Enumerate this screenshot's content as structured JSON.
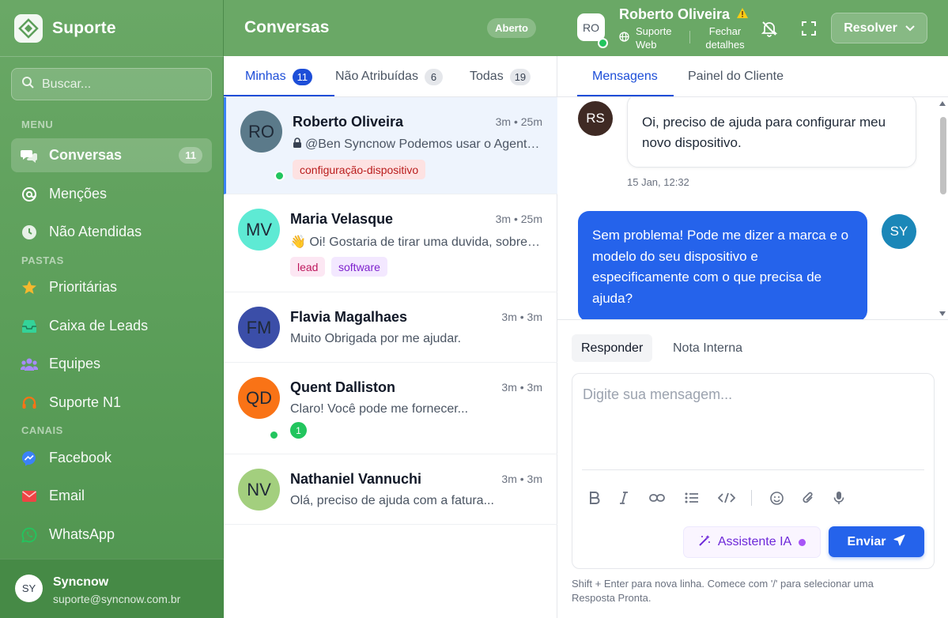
{
  "sidebar": {
    "brand": "Suporte",
    "search_placeholder": "Buscar...",
    "menu_label": "MENU",
    "folders_label": "PASTAS",
    "channels_label": "CANAIS",
    "menu": [
      {
        "label": "Conversas",
        "count": "11",
        "icon": "chat-bubbles-icon"
      },
      {
        "label": "Menções",
        "icon": "at-sign-icon"
      },
      {
        "label": "Não Atendidas",
        "icon": "clock-icon"
      }
    ],
    "folders": [
      {
        "label": "Prioritárias",
        "icon": "star-icon",
        "color": "#f5b82e"
      },
      {
        "label": "Caixa de Leads",
        "icon": "inbox-icon",
        "color": "#34d399"
      },
      {
        "label": "Equipes",
        "icon": "users-icon",
        "color": "#a78bfa"
      },
      {
        "label": "Suporte N1",
        "icon": "headset-icon",
        "color": "#f97316"
      }
    ],
    "channels": [
      {
        "label": "Facebook",
        "icon": "messenger-icon",
        "color": "#3b82f6"
      },
      {
        "label": "Email",
        "icon": "envelope-icon",
        "color": "#ef4444"
      },
      {
        "label": "WhatsApp",
        "icon": "whatsapp-icon",
        "color": "#22c55e"
      }
    ],
    "user": {
      "initials": "SY",
      "name": "Syncnow",
      "email": "suporte@syncnow.com.br"
    }
  },
  "conversations": {
    "title": "Conversas",
    "status": "Aberto",
    "tabs": [
      {
        "label": "Minhas",
        "count": "11"
      },
      {
        "label": "Não Atribuídas",
        "count": "6"
      },
      {
        "label": "Todas",
        "count": "19"
      }
    ],
    "items": [
      {
        "initials": "RO",
        "name": "Roberto Oliveira",
        "time": "3m • 25m",
        "preview": "@Ben Syncnow Podemos usar o Agente de IA para ajudar?",
        "tags": [
          "configuração-dispositivo"
        ],
        "avatar_color": "#5b7a8a",
        "online": true
      },
      {
        "initials": "MV",
        "name": "Maria Velasque",
        "time": "3m • 25m",
        "preview": "👋 Oi! Gostaria de tirar uma duvida, sobre o produto",
        "tags": [
          "lead",
          "software"
        ],
        "avatar_color": "#5eead4",
        "online": false
      },
      {
        "initials": "FM",
        "name": "Flavia Magalhaes",
        "time": "3m • 3m",
        "preview": "Muito Obrigada por me ajudar.",
        "tags": [],
        "avatar_color": "#3b4ea8",
        "online": false
      },
      {
        "initials": "QD",
        "name": "Quent Dalliston",
        "time": "3m • 3m",
        "preview": "Claro! Você pode me fornecer...",
        "tags": [],
        "avatar_color": "#f97316",
        "online": true,
        "unread": "1"
      },
      {
        "initials": "NV",
        "name": "Nathaniel Vannuchi",
        "time": "3m • 3m",
        "preview": "Olá, preciso de ajuda com a fatura...",
        "tags": [],
        "avatar_color": "#a3cf7e",
        "online": false
      }
    ]
  },
  "chat": {
    "contact_initials": "RO",
    "contact_name": "Roberto Oliveira",
    "channel": "Suporte Web",
    "close_details": "Fechar detalhes",
    "resolve_label": "Resolver",
    "tabs": [
      "Mensagens",
      "Painel do Cliente"
    ],
    "messages": [
      {
        "from": "RS",
        "direction": "in",
        "text": "Oi, preciso de ajuda para configurar meu novo dispositivo.",
        "time": "15 Jan, 12:32",
        "avatar_color": "#3f2a24"
      },
      {
        "from": "SY",
        "direction": "out",
        "text": "Sem problema! Pode me dizer a marca e o modelo do seu dispositivo e especificamente com o que precisa de ajuda?",
        "avatar_color": "#1b87b8"
      }
    ],
    "reply_tabs": [
      "Responder",
      "Nota Interna"
    ],
    "composer_placeholder": "Digite sua mensagem...",
    "ai_label": "Assistente IA",
    "send_label": "Enviar",
    "hint": "Shift + Enter para nova linha. Comece com '/' para selecionar uma Resposta Pronta."
  },
  "colors": {
    "brand_green": "#6aa866",
    "accent_blue": "#2563eb"
  }
}
